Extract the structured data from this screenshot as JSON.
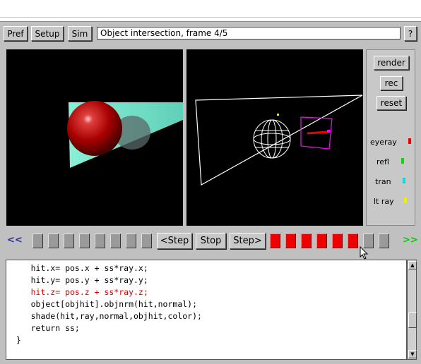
{
  "toolbar": {
    "pref_label": "Pref",
    "setup_label": "Setup",
    "sim_label": "Sim",
    "title": "Object intersection, frame 4/5",
    "help_label": "?"
  },
  "controls": {
    "render_label": "render",
    "rec_label": "rec",
    "reset_label": "reset"
  },
  "legend": [
    {
      "label": "eyeray",
      "color": "#ee0000"
    },
    {
      "label": "refl",
      "color": "#00dd00"
    },
    {
      "label": "tran",
      "color": "#00e0e0"
    },
    {
      "label": "lt ray",
      "color": "#eeee00"
    }
  ],
  "playback": {
    "rewind_label": "<<",
    "forward_label": ">>",
    "step_back_label": "<Step",
    "stop_label": "Stop",
    "step_fwd_label": "Step>",
    "colors": {
      "rewind": "#2a2a9a",
      "forward": "#00cc00"
    }
  },
  "code": {
    "lines": [
      "     hit.x= pos.x + ss*ray.x;",
      "     hit.y= pos.y + ss*ray.y;",
      "     hit.z= pos.z + ss*ray.z;",
      "     object[objhit].objnrm(hit,normal);",
      "     shade(hit,ray,normal,objhit,color);",
      "     return ss;",
      "  }"
    ],
    "highlight_line": 2,
    "highlight_color": "#e00000"
  }
}
